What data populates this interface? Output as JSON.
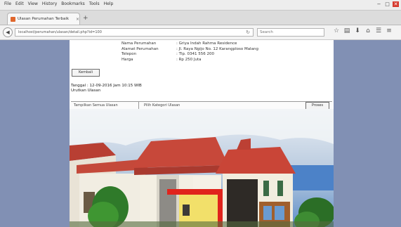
{
  "menubar": {
    "items": [
      "File",
      "Edit",
      "View",
      "History",
      "Bookmarks",
      "Tools",
      "Help"
    ],
    "controls": [
      "−",
      "□",
      "✕"
    ]
  },
  "tab": {
    "title": "Ulasan Perumahan Terbaik",
    "close": "×"
  },
  "newtab": "+",
  "navbar": {
    "back": "◀",
    "url": "localhost/perumahan/ulasan/detail.php?id=100",
    "reload": "↻",
    "search_placeholder": "Search",
    "tools": [
      "☆",
      "▤",
      "⬇",
      "⌂",
      "☰",
      "≡"
    ]
  },
  "info": [
    {
      "label": "Nama Perumahan",
      "value": ": Griya Indah Rahma Residence"
    },
    {
      "label": "Alamat Perumahan",
      "value": ": Jl. Raya Ngijo No. 12 Karangploso Malang"
    },
    {
      "label": "Telepon",
      "value": ": Tlp. 0341 556 200"
    },
    {
      "label": "Harga",
      "value": ": Rp 250 Juta"
    }
  ],
  "kembali": "Kembali",
  "tanggal": "Tanggal : 12-09-2016  Jam 10:15 WIB",
  "sorting": "Urutkan Ulasan",
  "filter": {
    "left": "Tampilkan Semua Ulasan",
    "right": "Pilih Kategori Ulasan",
    "button": "Proses"
  },
  "colors": {
    "desktop": "#8190b4",
    "roof": "#c23b2e",
    "accent_red": "#e0241c",
    "sky": "#5f8fc9"
  }
}
